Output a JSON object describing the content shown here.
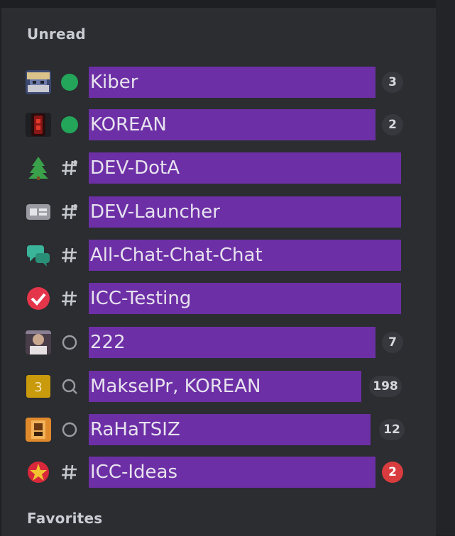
{
  "sections": {
    "unread_title": "Unread",
    "favorites_title": "Favorites"
  },
  "rows": [
    {
      "label": "Kiber",
      "status": "online",
      "badge": "3",
      "avatar": "pixel-character"
    },
    {
      "label": "KOREAN",
      "status": "online",
      "badge": "2",
      "avatar": "red-lantern"
    },
    {
      "label": "DEV-DotA",
      "status": "channel-hash-alt",
      "badge": "",
      "avatar": "green-tree"
    },
    {
      "label": "DEV-Launcher",
      "status": "channel-hash-alt",
      "badge": "",
      "avatar": "gray-logo"
    },
    {
      "label": "All-Chat-Chat-Chat",
      "status": "channel-hash",
      "badge": "",
      "avatar": "chat-bubbles"
    },
    {
      "label": "ICC-Testing",
      "status": "channel-hash",
      "badge": "",
      "avatar": "red-checkmark"
    },
    {
      "label": "222",
      "status": "offline",
      "badge": "7",
      "avatar": "photo-portrait"
    },
    {
      "label": "MakselPr, KOREAN",
      "status": "group-search",
      "badge": "198",
      "avatar": "yellow-number-3"
    },
    {
      "label": "RaHaTSIZ",
      "status": "offline",
      "badge": "12",
      "avatar": "orange-portrait"
    },
    {
      "label": "ICC-Ideas",
      "status": "channel-hash",
      "badge": "2",
      "badge_color": "#d83c3e",
      "avatar": "red-star"
    }
  ],
  "colors": {
    "highlight": "#6d2fa6",
    "online": "#23a55a",
    "badge_bg": "#36383d",
    "badge_alert": "#d83c3e",
    "panel_bg": "#2b2d31"
  }
}
